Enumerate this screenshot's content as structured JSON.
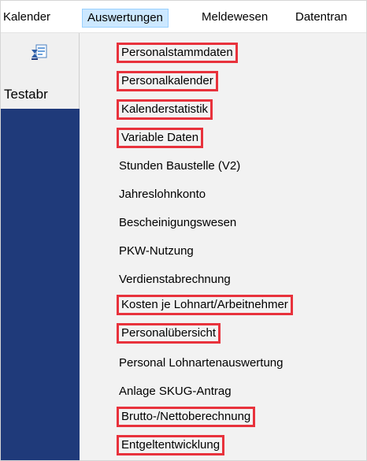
{
  "menubar": {
    "items": [
      {
        "label": "Kalender",
        "active": false
      },
      {
        "label": "Auswertungen",
        "active": true
      },
      {
        "label": "Meldewesen",
        "active": false
      },
      {
        "label": "Datentran",
        "active": false
      }
    ]
  },
  "ribbon": {
    "button_label": "Testabr",
    "icon": "payroll-document-hourglass-icon"
  },
  "dropdown": {
    "items": [
      {
        "label": "Personalstammdaten",
        "highlighted": true
      },
      {
        "label": "Personalkalender",
        "highlighted": true
      },
      {
        "label": "Kalenderstatistik",
        "highlighted": true
      },
      {
        "label": "Variable Daten",
        "highlighted": true
      },
      {
        "label": "Stunden Baustelle (V2)",
        "highlighted": false
      },
      {
        "label": "Jahreslohnkonto",
        "highlighted": false
      },
      {
        "label": "Bescheinigungswesen",
        "highlighted": false
      },
      {
        "label": "PKW-Nutzung",
        "highlighted": false
      },
      {
        "label": "Verdienstabrechnung",
        "highlighted": false
      },
      {
        "label": "Kosten je Lohnart/Arbeitnehmer",
        "highlighted": true
      },
      {
        "label": "Personalübersicht",
        "highlighted": true
      },
      {
        "label": "Personal Lohnartenauswertung",
        "highlighted": false
      },
      {
        "label": "Anlage SKUG-Antrag",
        "highlighted": false
      },
      {
        "label": "Brutto-/Nettoberechnung",
        "highlighted": true
      },
      {
        "label": "Entgeltentwicklung",
        "highlighted": true
      }
    ]
  },
  "colors": {
    "highlight_box": "#e8323c",
    "active_menu_bg": "#cce8ff",
    "sidebar_navy": "#1f3a7a",
    "dropdown_bg": "#f2f2f2"
  }
}
